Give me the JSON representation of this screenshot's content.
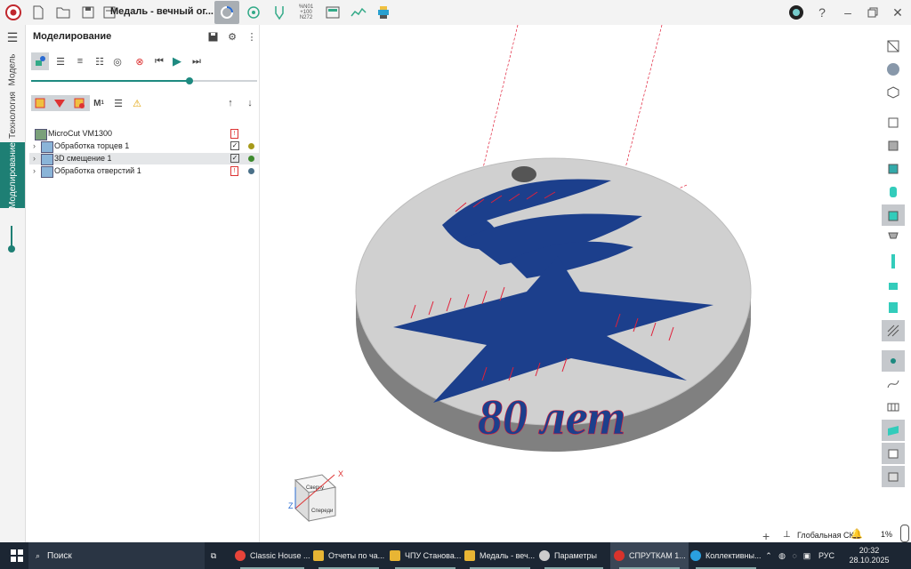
{
  "app": {
    "document_title": "Медаль - вечный ог..."
  },
  "left_rail": {
    "tabs": [
      "Модель",
      "Технология",
      "Моделирование"
    ],
    "active_tab": "Моделирование"
  },
  "panel": {
    "title": "Моделирование",
    "progress": 0.7
  },
  "tree": {
    "root": "MicroCut VM1300",
    "items": [
      {
        "label": "Обработка торцев 1",
        "checked": true,
        "dot_color": "#a79a1a"
      },
      {
        "label": "3D смещение 1",
        "checked": true,
        "dot_color": "#3e8a2e",
        "selected": true
      },
      {
        "label": "Обработка отверстий 1",
        "checked": false,
        "dot_color": "#4a7088"
      }
    ]
  },
  "toolbar": {
    "nc_badge": "%N01\n+100\nN272"
  },
  "model": {
    "engraving_text": "80 лет"
  },
  "viewcube": {
    "axis_x": "X",
    "axis_z": "Z",
    "face_top": "Сверху",
    "face_front": "Спереди"
  },
  "statusbar": {
    "coord_system": "Глобальная СК",
    "zoom": "1%"
  },
  "taskbar": {
    "search_label": "Поиск",
    "apps": [
      {
        "label": "Classic House ...",
        "color": "#e8443a"
      },
      {
        "label": "Отчеты по ча...",
        "color": "#e8b534"
      },
      {
        "label": "ЧПУ Станова...",
        "color": "#e8b534"
      },
      {
        "label": "Медаль - веч...",
        "color": "#e8b534"
      },
      {
        "label": "Параметры",
        "color": "#cccccc"
      },
      {
        "label": "СПРУТКАМ 1...",
        "color": "#d8332c"
      },
      {
        "label": "Коллективны...",
        "color": "#2aa0e0"
      }
    ],
    "language": "РУС",
    "time": "20:32",
    "date": "28.10.2025"
  },
  "colors": {
    "accent_teal": "#1e7f74",
    "toolpath_blue": "#1c3f8c",
    "toolpath_red": "#e0203a"
  }
}
